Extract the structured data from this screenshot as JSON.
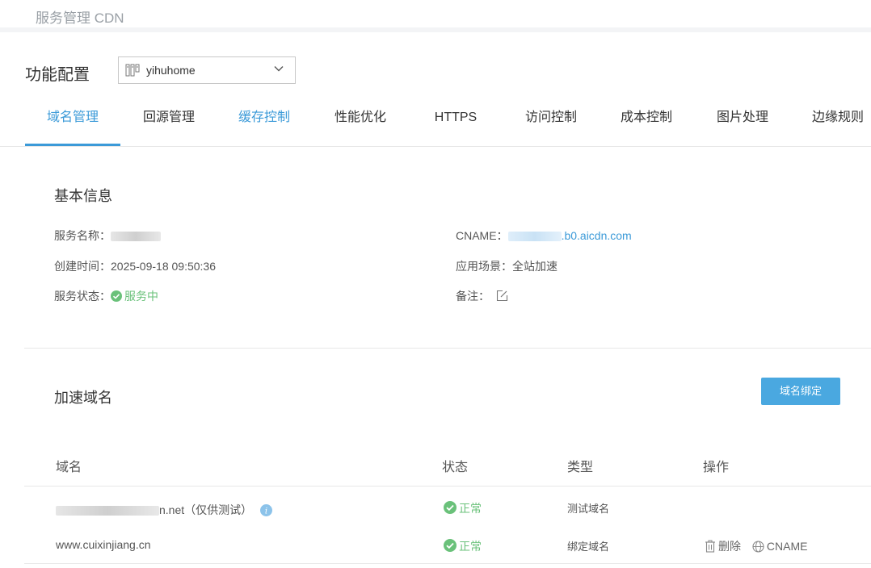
{
  "header": {
    "breadcrumb": "服务管理 CDN"
  },
  "config": {
    "label": "功能配置",
    "selected_service": "yihuhome"
  },
  "tabs": [
    {
      "label": "域名管理",
      "state": "active"
    },
    {
      "label": "回源管理",
      "state": "normal"
    },
    {
      "label": "缓存控制",
      "state": "hover"
    },
    {
      "label": "性能优化",
      "state": "normal"
    },
    {
      "label": "HTTPS",
      "state": "normal"
    },
    {
      "label": "访问控制",
      "state": "normal"
    },
    {
      "label": "成本控制",
      "state": "normal"
    },
    {
      "label": "图片处理",
      "state": "normal"
    },
    {
      "label": "边缘规则",
      "state": "normal"
    }
  ],
  "basic_info": {
    "title": "基本信息",
    "service_name_label": "服务名称：",
    "created_label": "创建时间：",
    "created_value": "2025-09-18 09:50:36",
    "status_label": "服务状态：",
    "status_value": "服务中",
    "cname_label": "CNAME：",
    "cname_suffix": ".b0.aicdn.com",
    "scene_label": "应用场景：",
    "scene_value": "全站加速",
    "remark_label": "备注："
  },
  "domains": {
    "title": "加速域名",
    "bind_button": "域名绑定",
    "columns": [
      "域名",
      "状态",
      "类型",
      "操作"
    ],
    "rows": [
      {
        "domain_suffix": "n.net（仅供测试）",
        "status": "正常",
        "type": "测试域名"
      },
      {
        "domain": "www.cuixinjiang.cn",
        "status": "正常",
        "type": "绑定域名",
        "op_delete": "删除",
        "op_cname": "CNAME"
      }
    ]
  },
  "colors": {
    "accent": "#3b9ad8",
    "success": "#6ac17a",
    "button": "#4aa8e0"
  }
}
